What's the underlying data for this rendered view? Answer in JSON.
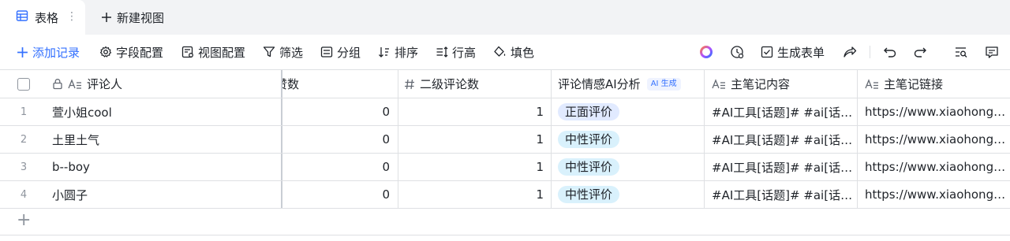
{
  "tabs": {
    "active_label": "表格",
    "more_glyph": "⋮",
    "new_view_label": "新建视图"
  },
  "toolbar": {
    "add_record": "添加记录",
    "field_config": "字段配置",
    "view_config": "视图配置",
    "filter": "筛选",
    "group": "分组",
    "sort": "排序",
    "row_height": "行高",
    "fill_color": "填色",
    "generate_form": "生成表单"
  },
  "columns": {
    "reviewer": "评论人",
    "likes": "赞数",
    "second_comments": "二级评论数",
    "sentiment": "评论情感AI分析",
    "ai_badge": "AI 生成",
    "note_content": "主笔记内容",
    "note_link": "主笔记链接"
  },
  "rows": [
    {
      "index": "1",
      "reviewer": "萱小姐cool",
      "likes": "0",
      "second_comments": "1",
      "sentiment": "正面评价",
      "note_content": "#AI工具[话题]# #ai[话…",
      "note_link": "https://www.xiaohongs…"
    },
    {
      "index": "2",
      "reviewer": "土里土气",
      "likes": "0",
      "second_comments": "1",
      "sentiment": "中性评价",
      "note_content": "#AI工具[话题]# #ai[话…",
      "note_link": "https://www.xiaohongs…"
    },
    {
      "index": "3",
      "reviewer": "b--boy",
      "likes": "0",
      "second_comments": "1",
      "sentiment": "中性评价",
      "note_content": "#AI工具[话题]# #ai[话…",
      "note_link": "https://www.xiaohongs…"
    },
    {
      "index": "4",
      "reviewer": "小圆子",
      "likes": "0",
      "second_comments": "1",
      "sentiment": "中性评价",
      "note_content": "#AI工具[话题]# #ai[话…",
      "note_link": "https://www.xiaohongs…"
    }
  ],
  "add_row_glyph": "+",
  "colors": {
    "accent": "#3370ff",
    "positive_tag": "#e1eaff",
    "neutral_tag": "#d9f1fc"
  }
}
